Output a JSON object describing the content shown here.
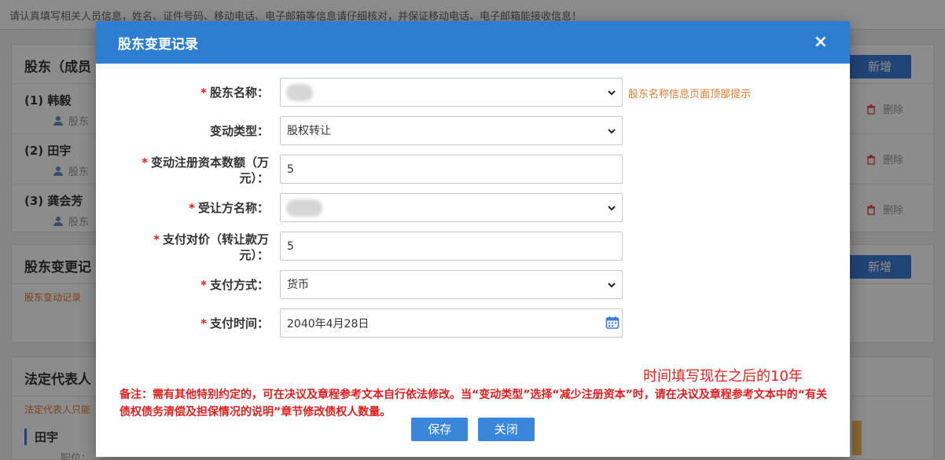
{
  "page": {
    "notice": "请认真填写相关人员信息，姓名、证件号码、移动电话、电子邮箱等信息请仔细核对，并保证移动电话、电子邮箱能接收信息！",
    "shareholders_panel": {
      "title": "股东（成员",
      "add_label": "新增",
      "rows": [
        {
          "name": "(1)  韩毅",
          "role": "股东",
          "delete": "删除"
        },
        {
          "name": "(2)  田宇",
          "role": "股东",
          "delete": "删除"
        },
        {
          "name": "(3)  龚会芳",
          "role": "股东",
          "delete": "删除"
        }
      ]
    },
    "change_panel": {
      "title": "股东变更记",
      "add_label": "新增",
      "note": "股东变动记录"
    },
    "legal_panel": {
      "title": "法定代表人",
      "note": "法定代表人只能",
      "person": "田宇",
      "position_label": "职位："
    }
  },
  "modal": {
    "title": "股东变更记录",
    "close": "×",
    "fields": {
      "shareholder_name": {
        "label": "股东名称：",
        "required": true,
        "hint": "股东名称信息页面顶部提示"
      },
      "change_type": {
        "label": "变动类型：",
        "required": false,
        "value": "股权转让"
      },
      "capital_amount": {
        "label_line1": "变动注册资本数额（万",
        "label_line2": "元）：",
        "required": true,
        "value": "5"
      },
      "transferee": {
        "label": "受让方名称：",
        "required": true
      },
      "payment_consideration": {
        "label_line1": "支付对价（转让款万",
        "label_line2": "元）：",
        "required": true,
        "value": "5"
      },
      "payment_method": {
        "label": "支付方式：",
        "required": true,
        "value": "货币"
      },
      "payment_time": {
        "label": "支付时间：",
        "required": true,
        "value": "2040年4月28日"
      }
    },
    "annotation": "时间填写现在之后的10年",
    "remark": "备注：需有其他特别约定的，可在决议及章程参考文本自行依法修改。当“变动类型”选择“减少注册资本”时，请在决议及章程参考文本中的“有关债权债务清偿及担保情况的说明”章节修改债权人数量。",
    "save_label": "保存",
    "close_label": "关闭"
  },
  "colors": {
    "header_blue": "#2d7ed3",
    "required_red": "#e02020",
    "hint_orange": "#e07a2e",
    "annotation_red": "#e8231f"
  }
}
